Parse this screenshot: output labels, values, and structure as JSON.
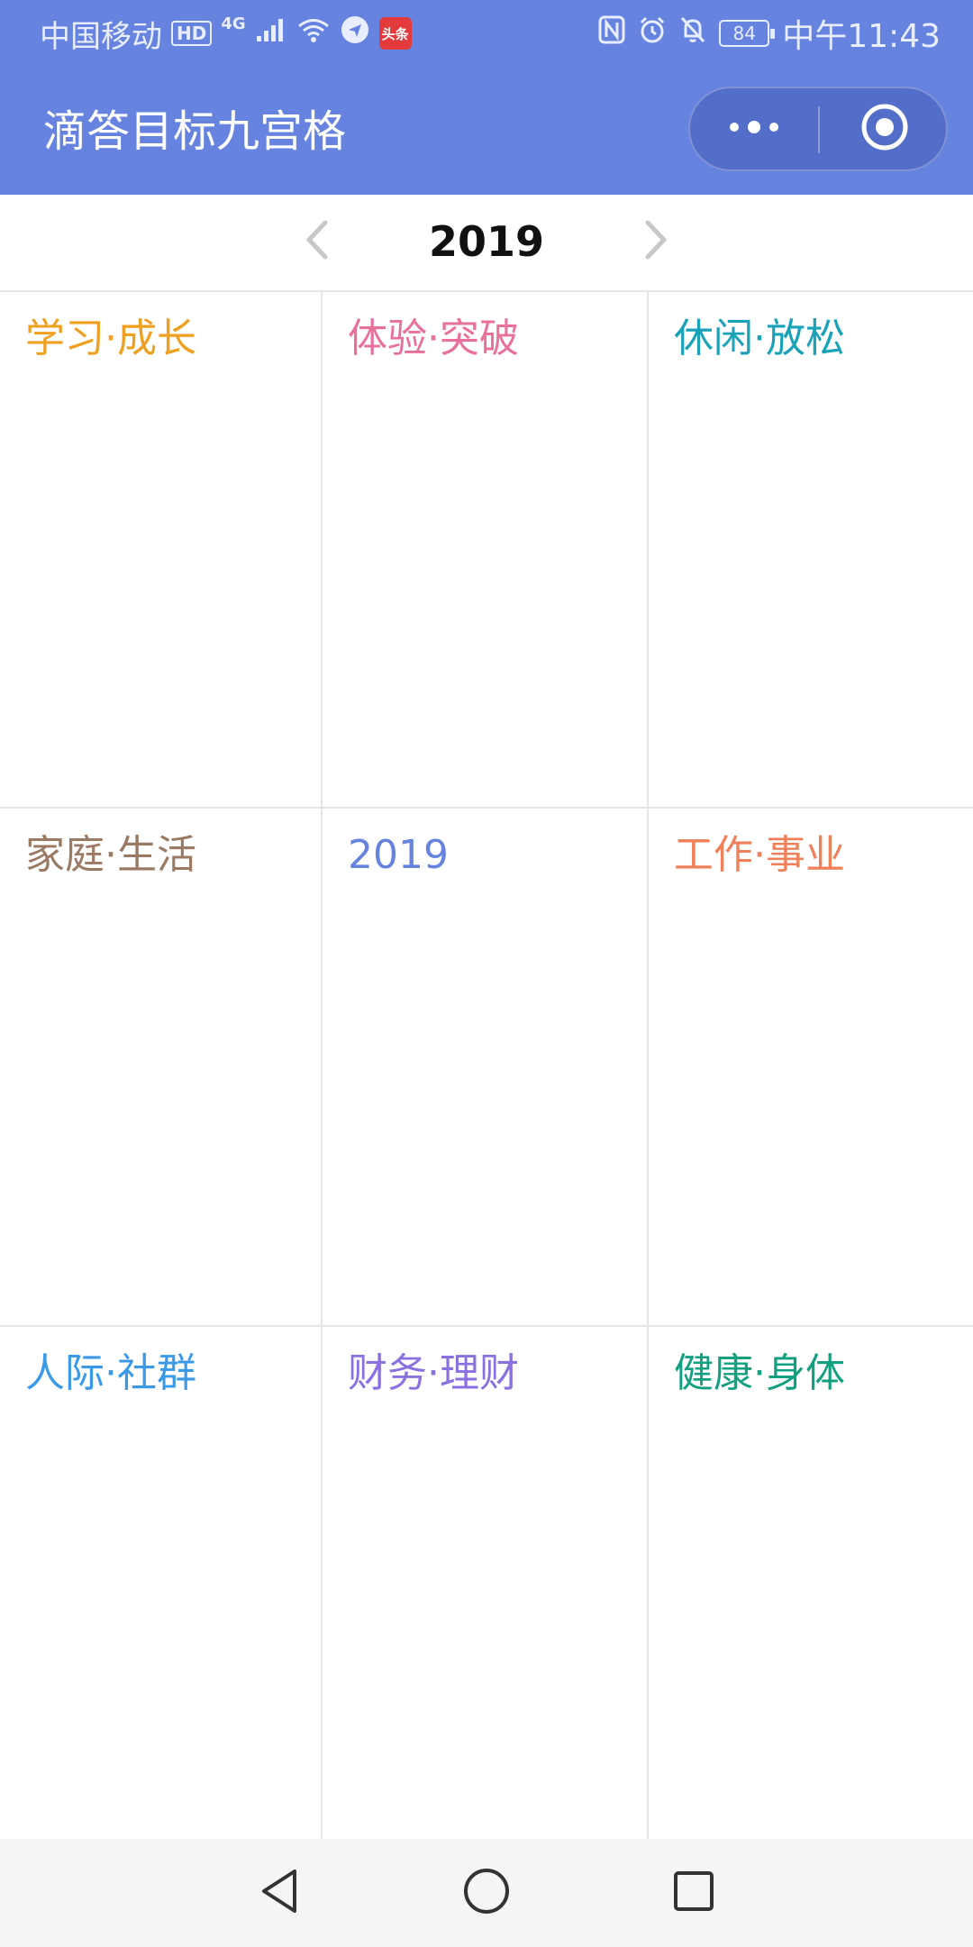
{
  "status_bar": {
    "carrier": "中国移动",
    "hd": "HD",
    "network": "4G",
    "app_badge": "头条",
    "battery": "84",
    "time": "中午11:43"
  },
  "app_bar": {
    "title": "滴答目标九宫格",
    "colors": {
      "bar": "#6683e0"
    }
  },
  "year_nav": {
    "year": "2019"
  },
  "grid": {
    "cells": [
      {
        "title": "学习·成长",
        "color": "#f0a020"
      },
      {
        "title": "体验·突破",
        "color": "#e8709a"
      },
      {
        "title": "休闲·放松",
        "color": "#1aa3b8"
      },
      {
        "title": "家庭·生活",
        "color": "#9a7a64"
      },
      {
        "title": "2019",
        "color": "#6683e0"
      },
      {
        "title": "工作·事业",
        "color": "#f0805a"
      },
      {
        "title": "人际·社群",
        "color": "#3a9ae8"
      },
      {
        "title": "财务·理财",
        "color": "#8a70e0"
      },
      {
        "title": "健康·身体",
        "color": "#12a080"
      }
    ]
  },
  "icons": {
    "capsule_more": "more-dots-icon",
    "capsule_close": "target-close-icon",
    "nav_back": "back-triangle-icon",
    "nav_home": "home-circle-icon",
    "nav_recent": "recent-square-icon"
  }
}
